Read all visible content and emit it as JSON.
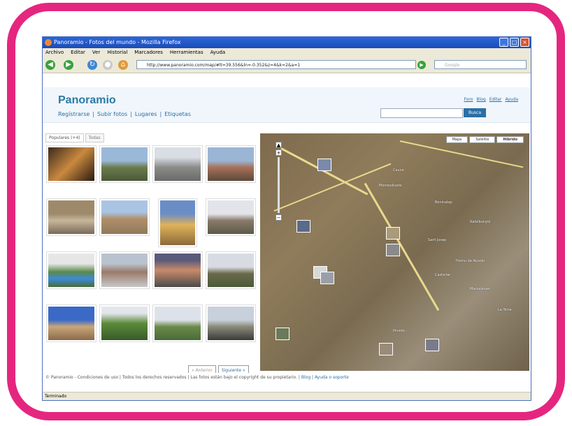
{
  "window": {
    "title": "Panoramio - Fotos del mundo - Mozilla Firefox"
  },
  "menubar": [
    "Archivo",
    "Editar",
    "Ver",
    "Historial",
    "Marcadores",
    "Herramientas",
    "Ayuda"
  ],
  "address": {
    "url": "http://www.panoramio.com/map/#lt=39.556&ln=-0.352&z=4&k=2&a=1"
  },
  "search": {
    "placeholder": "Google"
  },
  "header": {
    "logo": "Panoramio",
    "nav": [
      "Regístrarse",
      "|",
      "Subir fotos",
      "|",
      "Lugares",
      "|",
      "Etiquetas"
    ],
    "toplinks": [
      "Foro",
      "Blog",
      "Editar",
      "Ayuda"
    ],
    "search_button": "Busca"
  },
  "tabs": [
    "Populares (+4)",
    "Todas"
  ],
  "map": {
    "types": [
      "Mapa",
      "Satélite",
      "Híbrido"
    ],
    "labels": [
      "Cauce",
      "Monteolivete",
      "Benicalap",
      "Rafelbunyol",
      "Sant Josep",
      "Horno de Alcedo",
      "Castellar",
      "Marxalenes",
      "La Torre",
      "Pinedo"
    ]
  },
  "pager": {
    "prev": "« Anterior",
    "next": "Siguiente »"
  },
  "footer": {
    "text": "© Panoramio - Condiciones de uso | Todos los derechos reservados | Las fotos están bajo el copyright de su propietario. | ",
    "blog": "Blog",
    "help": "Ayuda o soporte"
  },
  "statusbar": {
    "text": "Terminado"
  },
  "colors": {
    "frame": "#e5267f",
    "accent": "#2b6fa6"
  }
}
